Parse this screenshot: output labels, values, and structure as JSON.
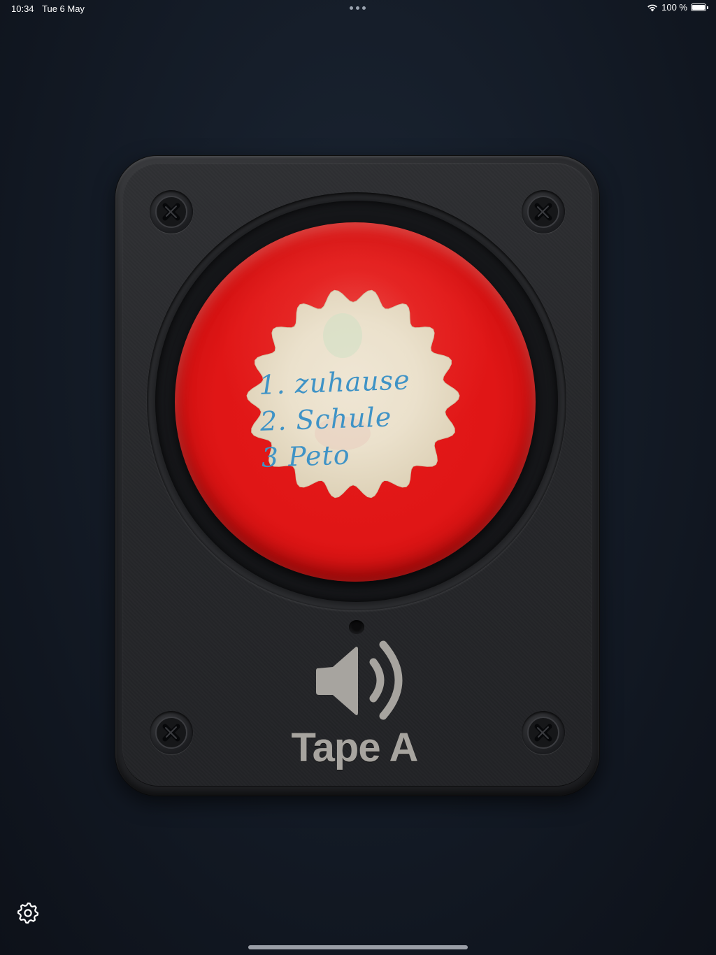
{
  "status_bar": {
    "time": "10:34",
    "date": "Tue 6 May",
    "battery_text": "100 %",
    "battery_level": 1.0
  },
  "button": {
    "label_lines": [
      "1. zuhause",
      "2. Schule",
      "3 Peto"
    ],
    "color": "#e01616"
  },
  "tape": {
    "name": "Tape A",
    "speaker_icon": "speaker-wave-icon"
  },
  "settings": {
    "icon": "gear-icon"
  },
  "colors": {
    "background": "#131a25",
    "housing": "#26272a",
    "tape_label": "#a7a49f",
    "sticker_ink": "#3f93c6"
  }
}
